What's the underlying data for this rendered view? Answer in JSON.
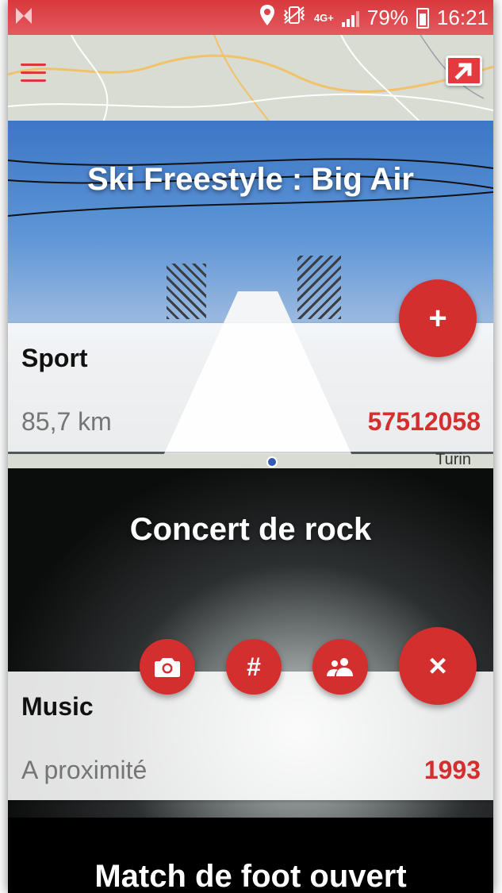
{
  "status_bar": {
    "network": "4G+",
    "battery": "79%",
    "time": "16:21"
  },
  "map": {
    "place_label": "Turin"
  },
  "events": [
    {
      "title": "Ski Freestyle : Big Air",
      "category": "Sport",
      "distance": "85,7 km",
      "count": "57512058"
    },
    {
      "title": "Concert de rock",
      "category": "Music",
      "distance": "A proximité",
      "count": "1993"
    },
    {
      "title": "Match de foot ouvert"
    }
  ],
  "actions": {
    "add_glyph": "+",
    "close_glyph": "×",
    "hashtag_glyph": "#"
  },
  "colors": {
    "accent": "#d32f2f",
    "status_bar": "#d9383d"
  }
}
